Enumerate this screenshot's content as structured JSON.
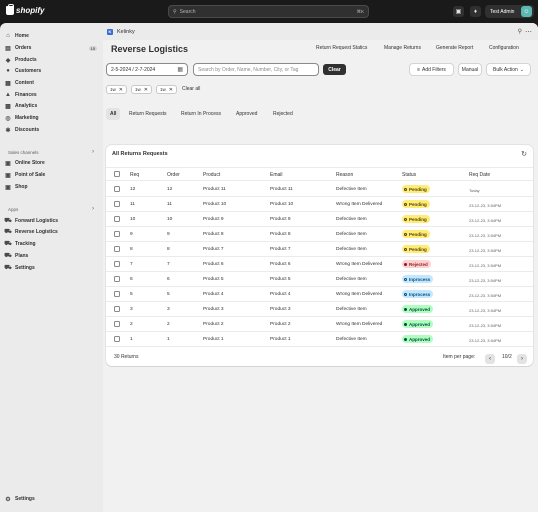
{
  "topbar": {
    "brand": "shopify",
    "search_placeholder": "Search",
    "search_shortcut": "⌘K",
    "account_name": "Test Admin"
  },
  "sidebar": {
    "main_items": [
      {
        "label": "Home",
        "icon": "home-icon"
      },
      {
        "label": "Orders",
        "icon": "orders-icon",
        "badge": "15"
      },
      {
        "label": "Products",
        "icon": "tag-icon"
      },
      {
        "label": "Customers",
        "icon": "person-icon"
      },
      {
        "label": "Content",
        "icon": "content-icon"
      },
      {
        "label": "Finances",
        "icon": "bank-icon"
      },
      {
        "label": "Analytics",
        "icon": "chart-icon"
      },
      {
        "label": "Marketing",
        "icon": "target-icon"
      },
      {
        "label": "Discounts",
        "icon": "discount-icon"
      }
    ],
    "sales_channels_heading": "Sales channels",
    "sales_channels": [
      {
        "label": "Online Store",
        "icon": "store-icon"
      },
      {
        "label": "Point of Sale",
        "icon": "pos-icon"
      },
      {
        "label": "Shop",
        "icon": "shop-icon"
      }
    ],
    "apps_heading": "Apps",
    "apps": [
      {
        "label": "Forward Logistics",
        "icon": "truck-icon"
      },
      {
        "label": "Reverse Logistics",
        "icon": "truck-icon"
      },
      {
        "label": "Tracking",
        "icon": "truck-icon"
      },
      {
        "label": "Plans",
        "icon": "truck-icon"
      },
      {
        "label": "Settings",
        "icon": "truck-icon"
      }
    ],
    "settings_label": "Settings"
  },
  "app_header": {
    "app_name": "Kelinky"
  },
  "page": {
    "title": "Reverse Logistics",
    "header_actions": [
      "Return Request Statics",
      "Manage Returns",
      "Generate Report",
      "Configuration"
    ],
    "date_range": "2-5-2024 / 2-7-2024",
    "search_placeholder": "Search by Order, Name, Number, City, or Tag",
    "clear_label": "Clear",
    "add_filters_label": "Add Filters",
    "manual_label": "Manual",
    "bulk_action_label": "Bulk Action",
    "filter_tags": [
      "1w",
      "1w",
      "1w"
    ],
    "clear_all_label": "Clear all",
    "tabs": [
      "All",
      "Return Requests",
      "Return In Process",
      "Approved",
      "Rejected"
    ],
    "active_tab": "All"
  },
  "table": {
    "title": "All Returns Requests",
    "columns": [
      "Req",
      "Order",
      "Product",
      "Email",
      "Reason",
      "Status",
      "Req Date"
    ],
    "rows": [
      {
        "req": "12",
        "order": "12",
        "product": "Product 11",
        "email": "Product 11",
        "reason": "Defective Item",
        "status": "Pending",
        "status_type": "pending",
        "date": "Today"
      },
      {
        "req": "11",
        "order": "11",
        "product": "Product 10",
        "email": "Product 10",
        "reason": "Wrong Item Delivered",
        "status": "Pending",
        "status_type": "pending",
        "date": "23-12-23, 3:54PM"
      },
      {
        "req": "10",
        "order": "10",
        "product": "Product 9",
        "email": "Product 9",
        "reason": "Defective Item",
        "status": "Pending",
        "status_type": "pending",
        "date": "23-12-23, 3:54PM"
      },
      {
        "req": "9",
        "order": "9",
        "product": "Product 8",
        "email": "Product 8",
        "reason": "Defective Item",
        "status": "Pending",
        "status_type": "pending",
        "date": "23-12-23, 3:54PM"
      },
      {
        "req": "8",
        "order": "8",
        "product": "Product 7",
        "email": "Product 7",
        "reason": "Defective Item",
        "status": "Pending",
        "status_type": "pending",
        "date": "23-12-23, 3:54PM"
      },
      {
        "req": "7",
        "order": "7",
        "product": "Product 6",
        "email": "Product 6",
        "reason": "Wrong Item Delivered",
        "status": "Rejected",
        "status_type": "rejected",
        "date": "23-12-23, 3:54PM"
      },
      {
        "req": "6",
        "order": "6",
        "product": "Product 5",
        "email": "Product 5",
        "reason": "Defective Item",
        "status": "Inprocess",
        "status_type": "inprocess",
        "date": "23-12-23, 3:54PM"
      },
      {
        "req": "5",
        "order": "5",
        "product": "Product 4",
        "email": "Product 4",
        "reason": "Wrong Item Delivered",
        "status": "Inprocess",
        "status_type": "inprocess",
        "date": "23-12-23, 3:54PM"
      },
      {
        "req": "3",
        "order": "3",
        "product": "Product 3",
        "email": "Product 3",
        "reason": "Defective Item",
        "status": "Approved",
        "status_type": "approved",
        "date": "23-12-23, 3:54PM"
      },
      {
        "req": "2",
        "order": "2",
        "product": "Product 2",
        "email": "Product 2",
        "reason": "Wrong Item Delivered",
        "status": "Approved",
        "status_type": "approved",
        "date": "23-12-23, 3:54PM"
      },
      {
        "req": "1",
        "order": "1",
        "product": "Product 1",
        "email": "Product 1",
        "reason": "Defective Item",
        "status": "Approved",
        "status_type": "approved",
        "date": "23-12-23, 3:54PM"
      }
    ],
    "footer_count": "30 Returns",
    "per_page_label": "Item per page:",
    "page_indicator": "10/2"
  },
  "colors": {
    "topbar_bg": "#1a1a1a",
    "pending": "#ffeb78",
    "rejected": "#fed1d7",
    "inprocess": "#c5e6ff",
    "approved": "#affebf"
  }
}
